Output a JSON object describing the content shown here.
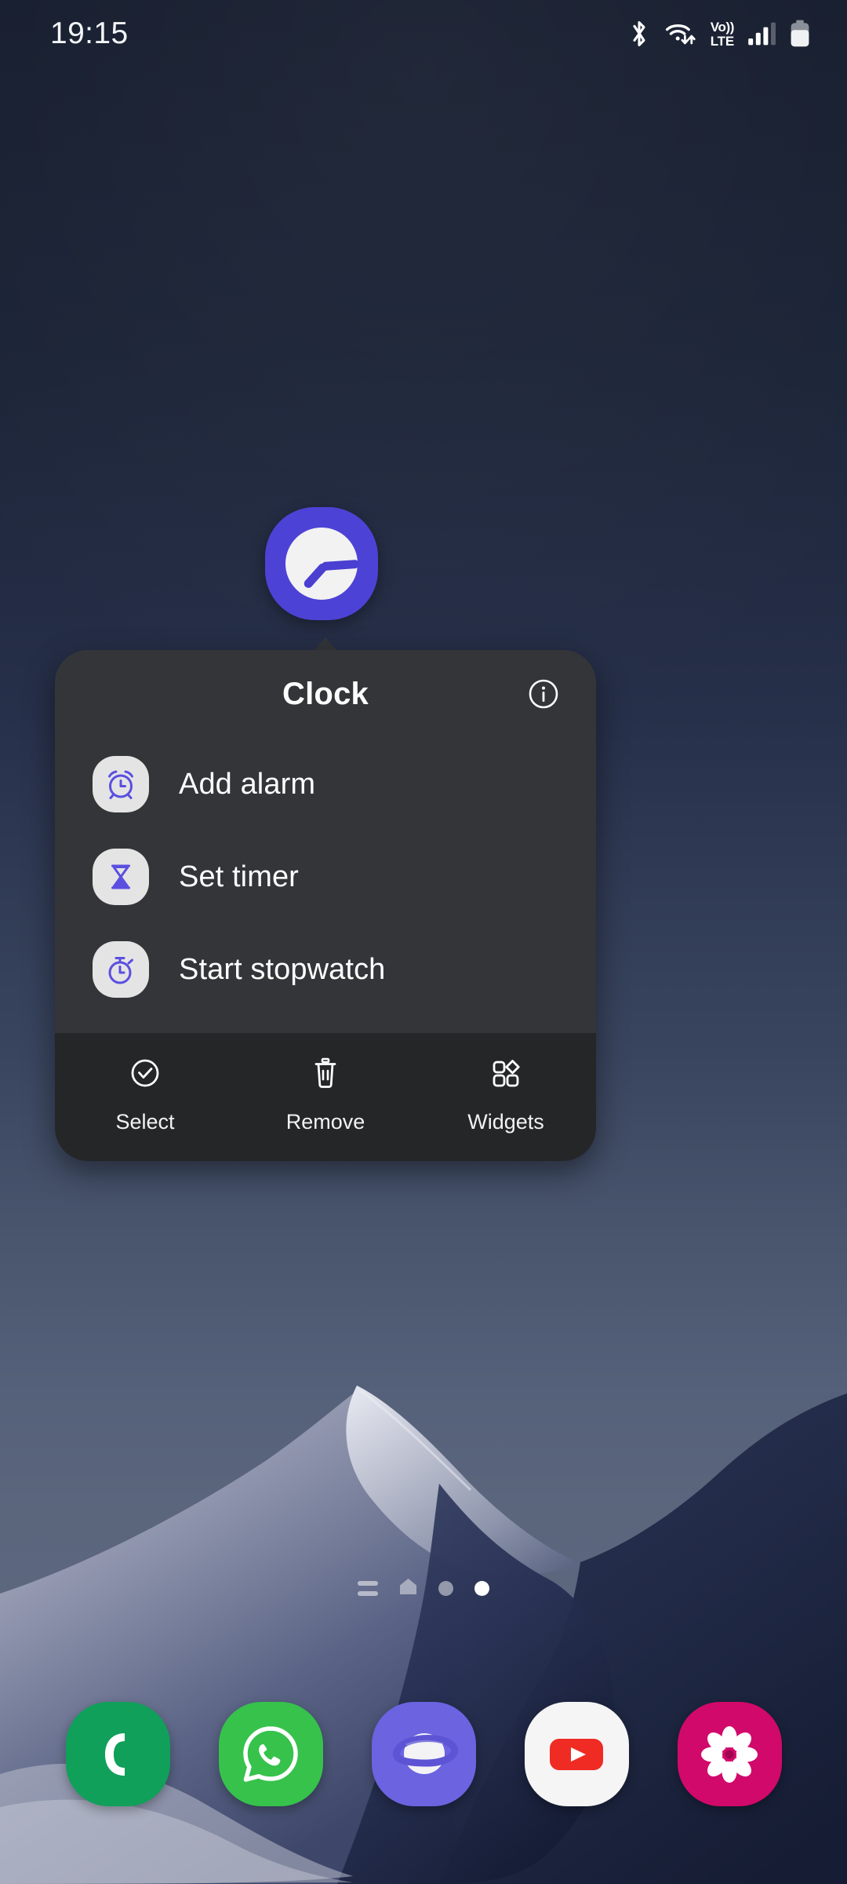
{
  "status_bar": {
    "time": "19:15",
    "icons": [
      {
        "name": "bluetooth-icon",
        "label": "Bluetooth"
      },
      {
        "name": "wifi-icon",
        "label": "Wi-Fi"
      },
      {
        "name": "volte-icon",
        "label_top": "Vo))",
        "label_bottom": "LTE"
      },
      {
        "name": "cellular-signal-icon",
        "label": "Signal"
      },
      {
        "name": "battery-icon",
        "label": "Battery"
      }
    ]
  },
  "app_icon": {
    "name": "clock-app-icon",
    "label": "Clock",
    "background_color": "#4d42d6",
    "face_color": "#f2f2f2",
    "hand_color": "#4a3fd0"
  },
  "popup": {
    "title": "Clock",
    "info_icon": "info-icon",
    "background_color": "#333538",
    "actions_background_color": "#252628",
    "shortcut_icon_color": "#5b4fe0",
    "shortcut_badge_color": "#e4e4e4",
    "shortcuts": [
      {
        "label": "Add alarm",
        "icon": "alarm-clock-icon"
      },
      {
        "label": "Set timer",
        "icon": "hourglass-icon"
      },
      {
        "label": "Start stopwatch",
        "icon": "stopwatch-icon"
      }
    ],
    "actions": [
      {
        "label": "Select",
        "icon": "check-circle-icon"
      },
      {
        "label": "Remove",
        "icon": "trash-icon"
      },
      {
        "label": "Widgets",
        "icon": "widgets-icon"
      }
    ]
  },
  "page_indicator": {
    "items": [
      {
        "type": "lines",
        "name": "app-list-indicator",
        "active": false
      },
      {
        "type": "home",
        "name": "home-page-indicator",
        "active": false
      },
      {
        "type": "dot",
        "name": "page-dot-1",
        "active": false
      },
      {
        "type": "dot",
        "name": "page-dot-2",
        "active": true
      }
    ],
    "active_index": 3,
    "active_color": "#ffffff",
    "inactive_color": "#c9cdd6"
  },
  "dock": {
    "apps": [
      {
        "name": "phone-app-icon",
        "label": "Phone",
        "color": "#10a05a"
      },
      {
        "name": "whatsapp-app-icon",
        "label": "WhatsApp",
        "color": "#36c24b"
      },
      {
        "name": "samsung-internet-app-icon",
        "label": "Samsung Internet",
        "color": "#6b63e0"
      },
      {
        "name": "youtube-app-icon",
        "label": "YouTube",
        "color": "#f5f5f5"
      },
      {
        "name": "gallery-app-icon",
        "label": "Gallery",
        "color": "#d1096b"
      }
    ]
  },
  "wallpaper": {
    "name": "dune-wallpaper",
    "sky_color": "#5e6a80",
    "dune_dark_color": "#1d2540"
  }
}
